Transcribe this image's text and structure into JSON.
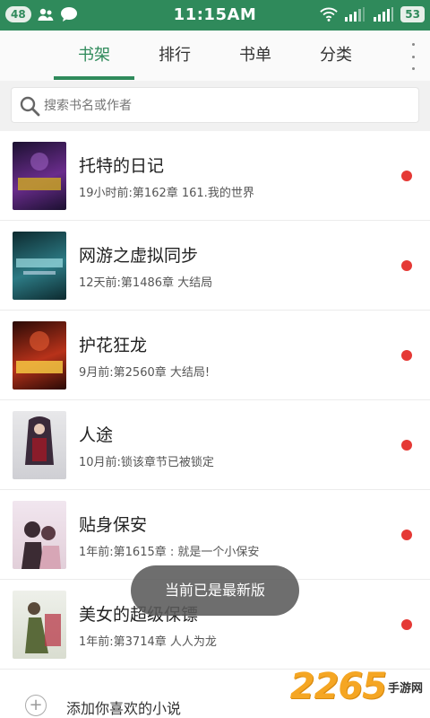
{
  "status_bar": {
    "notification_count": "48",
    "time": "11:15AM",
    "battery": "53",
    "icons": [
      "contacts-icon",
      "message-icon",
      "wifi-icon",
      "signal-icon"
    ]
  },
  "tabs": [
    {
      "label": "书架",
      "active": true
    },
    {
      "label": "排行",
      "active": false
    },
    {
      "label": "书单",
      "active": false
    },
    {
      "label": "分类",
      "active": false
    }
  ],
  "search": {
    "placeholder": "搜索书名或作者"
  },
  "books": [
    {
      "title": "托特的日记",
      "update": "19小时前:第162章 161.我的世界",
      "cover_colors": [
        "#1b1030",
        "#6a2c8c",
        "#c9a227"
      ]
    },
    {
      "title": "网游之虚拟同步",
      "update": "12天前:第1486章 大结局",
      "cover_colors": [
        "#0d2a2f",
        "#2c7a84",
        "#9fe0e6"
      ]
    },
    {
      "title": "护花狂龙",
      "update": "9月前:第2560章  大结局!",
      "cover_colors": [
        "#2a0a06",
        "#b8321a",
        "#f4c542"
      ]
    },
    {
      "title": "人途",
      "update": "10月前:锁该章节已被锁定",
      "cover_colors": [
        "#e8e8ea",
        "#3a2a3a",
        "#8a1c2a"
      ]
    },
    {
      "title": "贴身保安",
      "update": "1年前:第1615章 :  就是一个小保安",
      "cover_colors": [
        "#f1e6ef",
        "#3b2b33",
        "#d7a6b6"
      ]
    },
    {
      "title": "美女的超级保镖",
      "update": "1年前:第3714章 人人为龙",
      "cover_colors": [
        "#eef0ea",
        "#5a6a3a",
        "#b83a4a"
      ]
    }
  ],
  "add_row": {
    "label": "添加你喜欢的小说"
  },
  "toast": {
    "text": "当前已是最新版"
  },
  "watermark": {
    "number": "2265",
    "text": "手游网"
  },
  "colors": {
    "accent": "#2f8a5b",
    "unread_dot": "#e53935"
  }
}
